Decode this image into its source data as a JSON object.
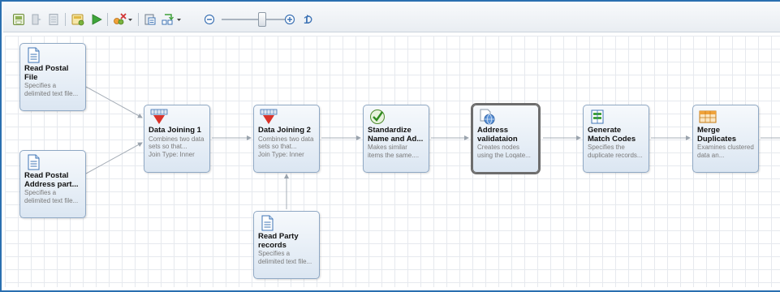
{
  "toolbar": {
    "tools": [
      {
        "name": "save-icon"
      },
      {
        "name": "import-icon"
      },
      {
        "name": "list-icon"
      },
      {
        "name": "new-node-icon"
      },
      {
        "name": "run-icon"
      },
      {
        "name": "tools-dropdown-icon"
      },
      {
        "name": "clipboard-icon"
      },
      {
        "name": "layout-dropdown-icon"
      },
      {
        "name": "zoom-out-icon"
      },
      {
        "name": "zoom-in-icon"
      },
      {
        "name": "reset-zoom-icon"
      }
    ]
  },
  "nodes": [
    {
      "id": "n1",
      "title": "Read Postal File",
      "desc": "Specifies a delimited text file...",
      "extra": "",
      "icon": "document-icon"
    },
    {
      "id": "n2",
      "title": "Read Postal Address part...",
      "desc": "Specifies a delimited text file...",
      "extra": "",
      "icon": "document-icon"
    },
    {
      "id": "n3",
      "title": "Data Joining 1",
      "desc": "Combines two data sets so that...",
      "extra": "Join Type: Inner",
      "icon": "join-icon"
    },
    {
      "id": "n4",
      "title": "Data Joining 2",
      "desc": "Combines two data sets so that...",
      "extra": "Join Type: Inner",
      "icon": "join-icon"
    },
    {
      "id": "n5",
      "title": "Read Party records",
      "desc": "Specifies a delimited text file...",
      "extra": "",
      "icon": "document-icon"
    },
    {
      "id": "n6",
      "title": "Standardize Name and Ad...",
      "desc": "Makes similar items the same....",
      "extra": "",
      "icon": "checkmark-icon"
    },
    {
      "id": "n7",
      "title": "Address validataion",
      "desc": "Creates nodes using the Loqate...",
      "extra": "",
      "icon": "globe-document-icon"
    },
    {
      "id": "n8",
      "title": "Generate Match Codes",
      "desc": "Specifies the duplicate records...",
      "extra": "",
      "icon": "match-codes-icon"
    },
    {
      "id": "n9",
      "title": "Merge Duplicates",
      "desc": "Examines clustered data an...",
      "extra": "",
      "icon": "merge-icon"
    }
  ]
}
